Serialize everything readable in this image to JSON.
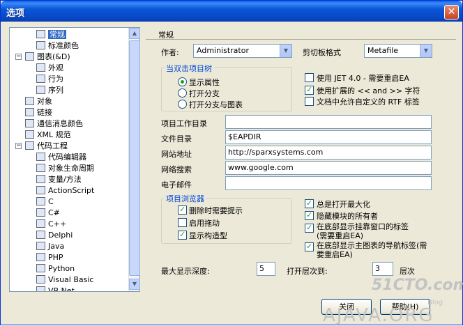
{
  "window": {
    "title": "选项",
    "close_label": "✕"
  },
  "tree": {
    "items": [
      {
        "label": "常规",
        "depth": 1,
        "selected": true
      },
      {
        "label": "标准颜色",
        "depth": 1
      },
      {
        "label": "图表(&D)",
        "depth": 0,
        "expander": "−"
      },
      {
        "label": "外观",
        "depth": 1
      },
      {
        "label": "行为",
        "depth": 1
      },
      {
        "label": "序列",
        "depth": 1
      },
      {
        "label": "对象",
        "depth": 0
      },
      {
        "label": "链接",
        "depth": 0
      },
      {
        "label": "通信消息颜色",
        "depth": 0
      },
      {
        "label": "XML 规范",
        "depth": 0
      },
      {
        "label": "代码工程",
        "depth": 0,
        "expander": "−"
      },
      {
        "label": "代码编辑器",
        "depth": 1
      },
      {
        "label": "对象生命周期",
        "depth": 1
      },
      {
        "label": "变量/方法",
        "depth": 1
      },
      {
        "label": "ActionScript",
        "depth": 1
      },
      {
        "label": "C",
        "depth": 1
      },
      {
        "label": "C#",
        "depth": 1
      },
      {
        "label": "C++",
        "depth": 1
      },
      {
        "label": "Delphi",
        "depth": 1
      },
      {
        "label": "Java",
        "depth": 1
      },
      {
        "label": "PHP",
        "depth": 1
      },
      {
        "label": "Python",
        "depth": 1
      },
      {
        "label": "Visual Basic",
        "depth": 1
      },
      {
        "label": "VB.Net",
        "depth": 1
      }
    ]
  },
  "general": {
    "section_title": "常规",
    "author_label": "作者:",
    "author_value": "Administrator",
    "clipboard_label": "剪切板格式",
    "clipboard_value": "Metafile",
    "dblclick_group": "当双击项目树",
    "dblclick_options": [
      "显示属性",
      "打开分支",
      "打开分支与图表"
    ],
    "checks_top": [
      {
        "label": "使用 JET 4.0 - 需要重启EA",
        "checked": false
      },
      {
        "label": "使用扩展的 << and >> 字符",
        "checked": true
      },
      {
        "label": "文档中允许自定义的 RTF 标签",
        "checked": false
      }
    ],
    "dir_rows": [
      {
        "label": "项目工作目录",
        "value": ""
      },
      {
        "label": "文件目录",
        "value": "$EAPDIR"
      },
      {
        "label": "网站地址",
        "value": "http://sparxsystems.com"
      },
      {
        "label": "网络搜索",
        "value": "www.google.com"
      },
      {
        "label": "电子邮件",
        "value": ""
      }
    ],
    "browser_group": "项目浏览器",
    "browser_checks": [
      {
        "label": "删除时需要提示",
        "checked": true
      },
      {
        "label": "启用拖动",
        "checked": false
      },
      {
        "label": "显示构造型",
        "checked": true
      }
    ],
    "right_checks": [
      {
        "label": "总是打开最大化",
        "checked": true
      },
      {
        "label": "隐藏模块的所有者",
        "checked": true
      },
      {
        "label": "在底部显示挂靠窗口的标签(需要重启EA)",
        "checked": true
      },
      {
        "label": "在底部显示主图表的导航标签(需要重启EA)",
        "checked": true
      }
    ],
    "max_depth_label": "最大显示深度:",
    "max_depth_value": "5",
    "open_level_label": "打开层次到:",
    "open_level_value": "3",
    "level_unit": "层次"
  },
  "buttons": {
    "close": "关闭",
    "help": "帮助(H)"
  },
  "watermark": {
    "line1": "51CTO.com",
    "line2": "AJAVA.ORG",
    "line3": "Blog"
  }
}
